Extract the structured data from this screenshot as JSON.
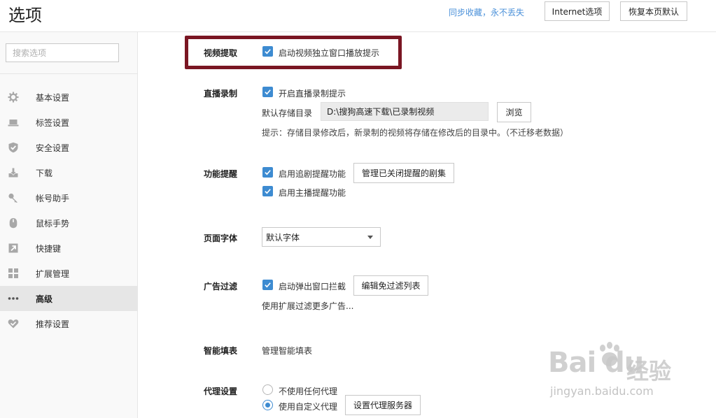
{
  "header": {
    "title": "选项",
    "sync_link": "同步收藏，永不丢失",
    "internet_button": "Internet选项",
    "restore_button": "恢复本页默认"
  },
  "sidebar": {
    "search_placeholder": "搜索选项",
    "items": [
      {
        "label": "基本设置",
        "icon": "gear-icon"
      },
      {
        "label": "标签设置",
        "icon": "laptop-icon"
      },
      {
        "label": "安全设置",
        "icon": "shield-check-icon"
      },
      {
        "label": "下载",
        "icon": "download-icon"
      },
      {
        "label": "帐号助手",
        "icon": "key-icon"
      },
      {
        "label": "鼠标手势",
        "icon": "mouse-icon"
      },
      {
        "label": "快捷键",
        "icon": "shortcut-arrow-icon"
      },
      {
        "label": "扩展管理",
        "icon": "grid-icon"
      },
      {
        "label": "高级",
        "icon": "more-dots-icon",
        "active": true
      },
      {
        "label": "推荐设置",
        "icon": "heart-icon"
      }
    ]
  },
  "sections": {
    "video": {
      "label": "视频提取",
      "checkbox": "启动视频独立窗口播放提示",
      "checked": true
    },
    "live": {
      "label": "直播录制",
      "checkbox": "开启直播录制提示",
      "checked": true,
      "dir_label": "默认存储目录",
      "dir_value": "D:\\搜狗高速下载\\已录制视频",
      "browse_button": "浏览",
      "hint": "提示：存储目录修改后，新录制的视频将存储在修改后的目录中。（不迁移老数据）"
    },
    "reminder": {
      "label": "功能提醒",
      "checkbox1": "启用追剧提醒功能",
      "manage_button": "管理已关闭提醒的剧集",
      "checkbox2": "启用主播提醒功能",
      "checked1": true,
      "checked2": true
    },
    "font": {
      "label": "页面字体",
      "selected": "默认字体"
    },
    "adfilter": {
      "label": "广告过滤",
      "checkbox": "启动弹出窗口拦截",
      "checked": true,
      "edit_button": "编辑免过滤列表",
      "more_link": "使用扩展过滤更多广告..."
    },
    "autofill": {
      "label": "智能填表",
      "link": "管理智能填表"
    },
    "proxy": {
      "label": "代理设置",
      "option1": "不使用任何代理",
      "option2": "使用自定义代理",
      "selected": "option2",
      "server_button": "设置代理服务器"
    }
  },
  "watermark": {
    "logo": "Bai du",
    "cn": "经验",
    "url": "jingyan.baidu.com"
  },
  "colors": {
    "accent": "#3d8bd1",
    "highlight_border": "#7a1623",
    "link": "#4a90d9"
  }
}
